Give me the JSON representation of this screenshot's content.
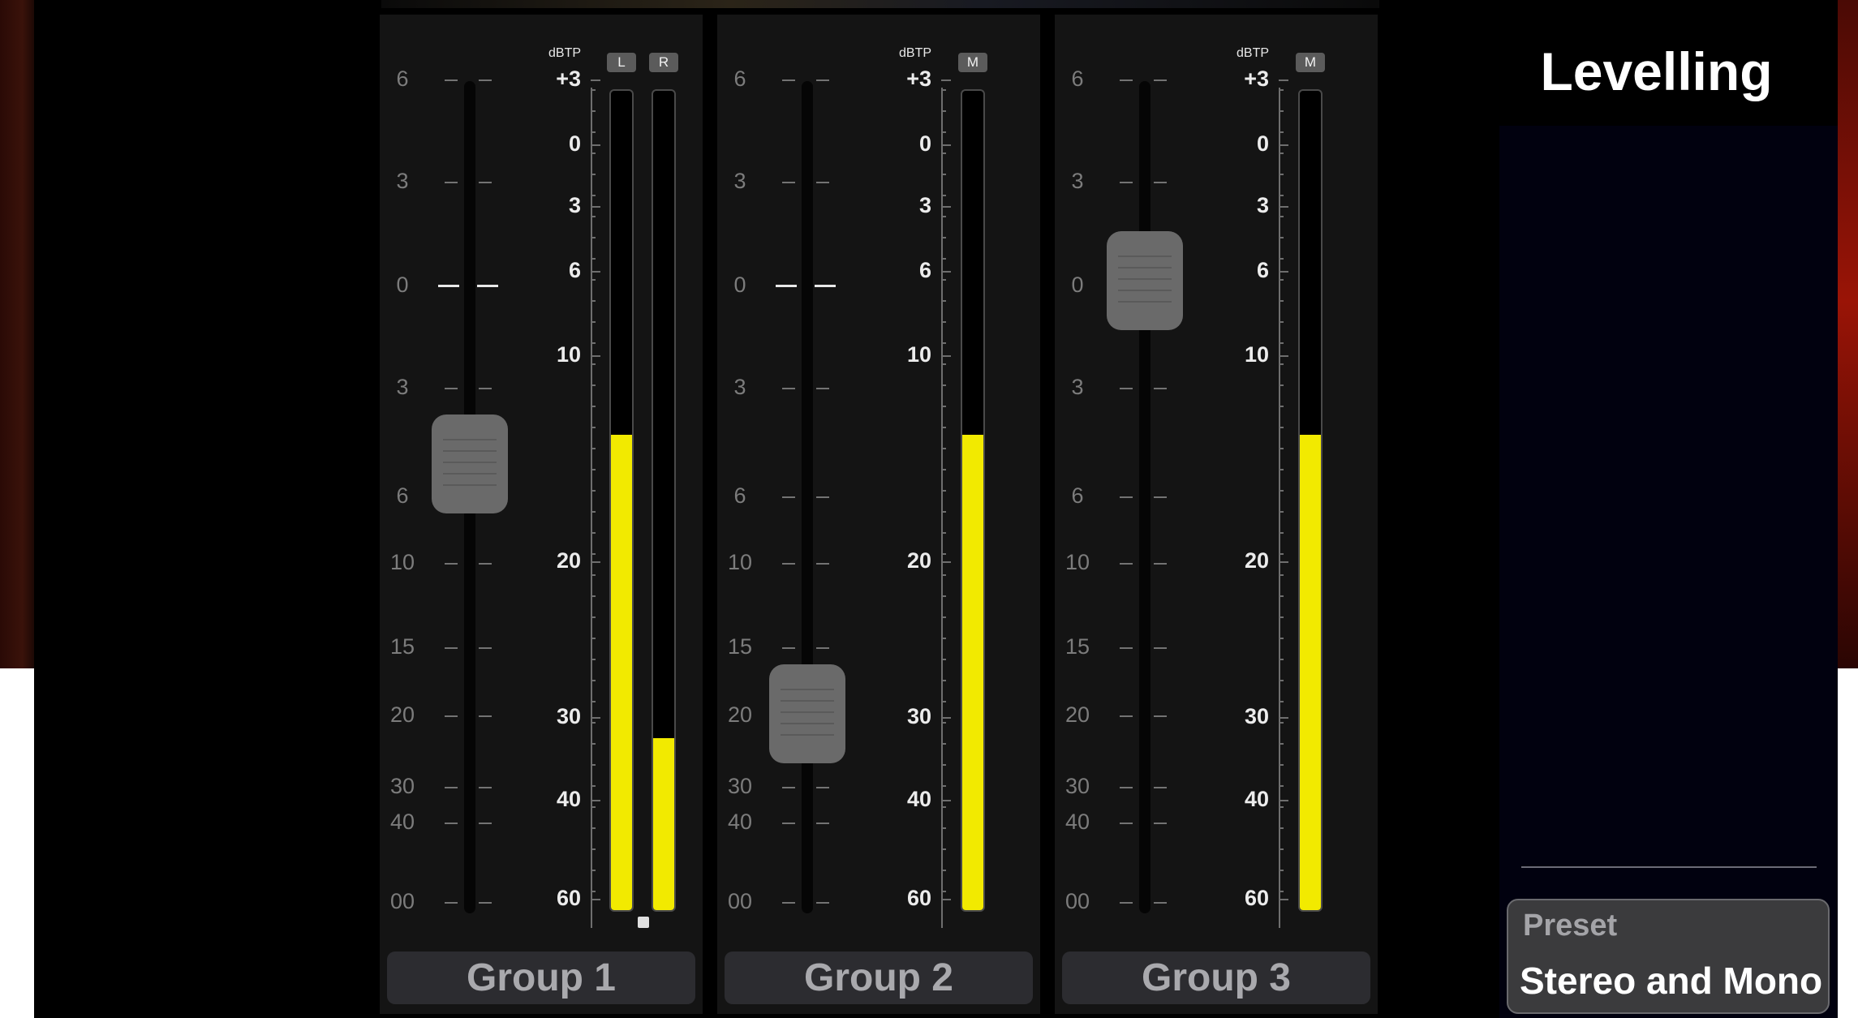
{
  "app": {
    "title": "Levelling"
  },
  "fader_scale": [
    "6",
    "3",
    "0",
    "3",
    "6",
    "10",
    "15",
    "20",
    "30",
    "40",
    "00"
  ],
  "meter_scale": {
    "unit": "dBTP",
    "labels": [
      "+3",
      "0",
      "3",
      "6",
      "10",
      "20",
      "30",
      "40",
      "60"
    ]
  },
  "groups": [
    {
      "name": "Group 1",
      "fader_level": 0.54,
      "channels": [
        {
          "label": "L",
          "level": 0.58
        },
        {
          "label": "R",
          "level": 0.21
        }
      ]
    },
    {
      "name": "Group 2",
      "fader_level": 0.24,
      "channels": [
        {
          "label": "M",
          "level": 0.58
        }
      ]
    },
    {
      "name": "Group 3",
      "fader_level": 0.76,
      "channels": [
        {
          "label": "M",
          "level": 0.58
        }
      ]
    }
  ],
  "preset": {
    "label": "Preset",
    "value": "Stereo and Mono"
  },
  "colors": {
    "meter_fill": "#f2ea00",
    "panel": "#141414",
    "background": "#000000"
  }
}
